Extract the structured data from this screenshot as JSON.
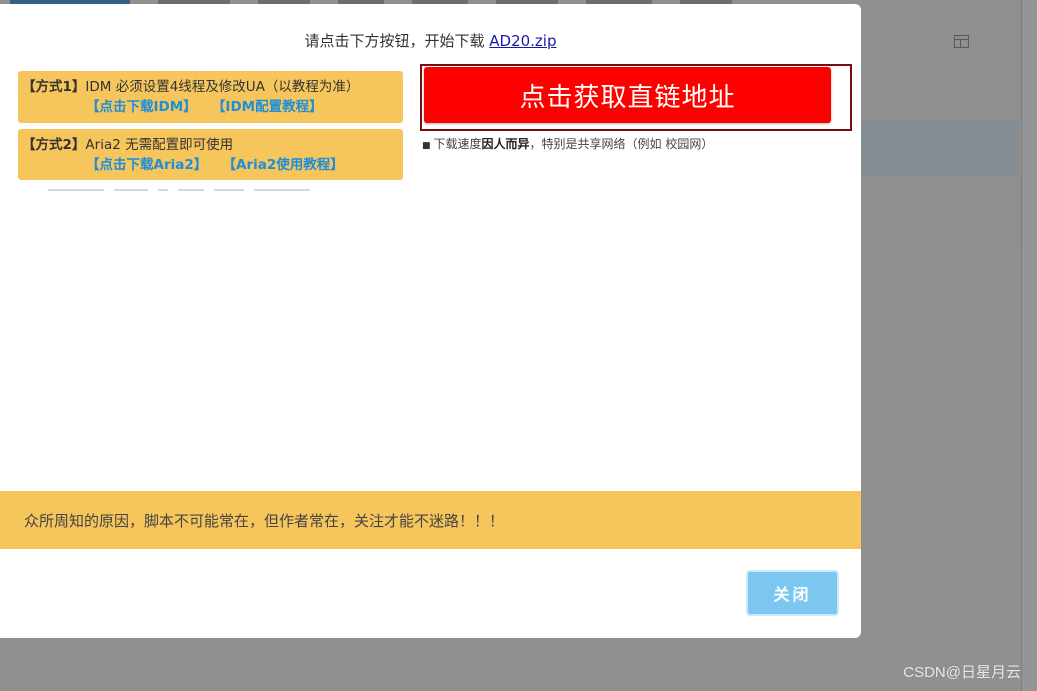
{
  "modal": {
    "title_prefix": "请点击下方按钮，开始下载 ",
    "file_name": "AD20.zip",
    "method1": {
      "tag": "【方式1】",
      "text": "IDM 必须设置4线程及修改UA（以教程为准）",
      "link1": "【点击下载IDM】",
      "link2": "【IDM配置教程】"
    },
    "method2": {
      "tag": "【方式2】",
      "text": "Aria2 无需配置即可使用",
      "link1": "【点击下载Aria2】",
      "link2": "【Aria2使用教程】"
    },
    "get_link_label": "点击获取直链地址",
    "speed_note_prefix": "下载速度",
    "speed_note_bold": "因人而异",
    "speed_note_suffix": "，特别是共享网络（例如 校园网）",
    "footer_notice": "众所周知的原因，脚本不可能常在，但作者常在，关注才能不迷路！！！",
    "close_label": "关闭"
  },
  "watermark": "CSDN@日星月云",
  "colors": {
    "accent_yellow": "#f6c65c",
    "link_blue": "#1f8ed8",
    "get_link_red": "#ff0000",
    "close_blue": "#7cc7f0"
  }
}
